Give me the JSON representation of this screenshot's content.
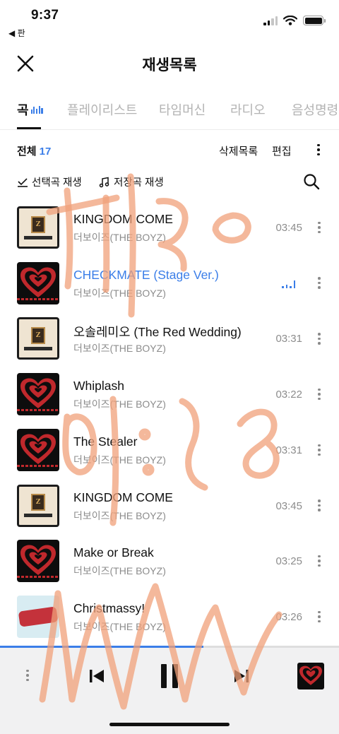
{
  "status_bar": {
    "time": "9:37",
    "back_app": "◀ 판"
  },
  "header": {
    "title": "재생목록",
    "close_icon": "close-icon"
  },
  "tabs": [
    {
      "label": "곡",
      "active": true
    },
    {
      "label": "플레이리스트",
      "active": false
    },
    {
      "label": "타임머신",
      "active": false
    },
    {
      "label": "라디오",
      "active": false
    },
    {
      "label": "음성명령",
      "active": false
    }
  ],
  "toolbar": {
    "total_label": "전체",
    "total_count": "17",
    "delete_label": "삭제목록",
    "edit_label": "편집"
  },
  "actions": {
    "play_selected": "선택곡 재생",
    "play_saved": "저장곡 재생",
    "search_icon": "search-icon"
  },
  "songs": [
    {
      "title": "KINGDOM COME",
      "artist": "더보이즈(THE BOYZ)",
      "duration": "03:45",
      "art": "gold",
      "playing": false
    },
    {
      "title": "CHECKMATE (Stage Ver.)",
      "artist": "더보이즈(THE BOYZ)",
      "duration": "",
      "art": "red",
      "playing": true
    },
    {
      "title": "오솔레미오 (The Red Wedding)",
      "artist": "더보이즈(THE BOYZ)",
      "duration": "03:31",
      "art": "gold",
      "playing": false
    },
    {
      "title": "Whiplash",
      "artist": "더보이즈(THE BOYZ)",
      "duration": "03:22",
      "art": "red",
      "playing": false
    },
    {
      "title": "The Stealer",
      "artist": "더보이즈(THE BOYZ)",
      "duration": "03:31",
      "art": "red",
      "playing": false
    },
    {
      "title": "KINGDOM COME",
      "artist": "더보이즈(THE BOYZ)",
      "duration": "03:45",
      "art": "gold",
      "playing": false
    },
    {
      "title": "Make or Break",
      "artist": "더보이즈(THE BOYZ)",
      "duration": "03:25",
      "art": "red",
      "playing": false
    },
    {
      "title": "Christmassy!",
      "artist": "더보이즈(THE BOYZ)",
      "duration": "03:26",
      "art": "xmas",
      "playing": false
    }
  ],
  "player": {
    "progress": 0.6,
    "state": "playing"
  },
  "colors": {
    "accent": "#3b7ee8",
    "muted": "#8c8c8c",
    "player_bg": "#f1f1f2",
    "scribble": "#f0a07a"
  }
}
